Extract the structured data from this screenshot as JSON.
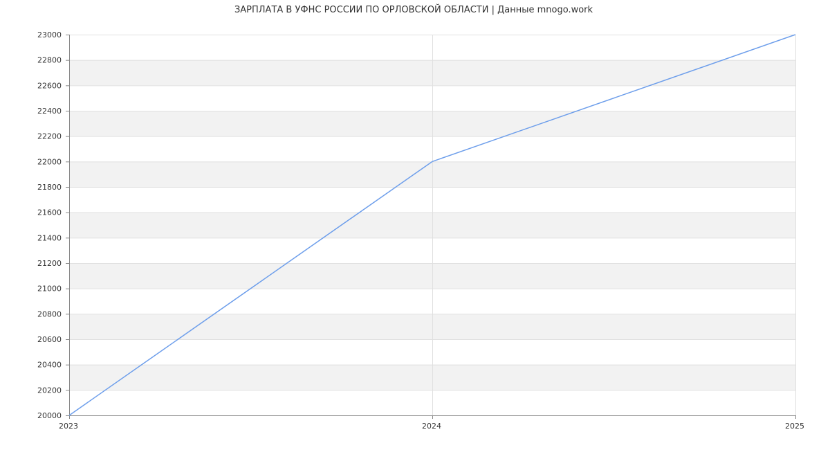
{
  "chart_data": {
    "type": "line",
    "title": "ЗАРПЛАТА В УФНС РОССИИ ПО ОРЛОВСКОЙ  ОБЛАСТИ | Данные mnogo.work",
    "xlabel": "",
    "ylabel": "",
    "x": [
      "2023",
      "2024",
      "2025"
    ],
    "series": [
      {
        "values": [
          20000,
          22000,
          23000
        ],
        "color": "#6d9eeb"
      }
    ],
    "ylim": [
      20000,
      23000
    ],
    "yticks": [
      20000,
      20200,
      20400,
      20600,
      20800,
      21000,
      21200,
      21400,
      21600,
      21800,
      22000,
      22200,
      22400,
      22600,
      22800,
      23000
    ],
    "grid": true,
    "band_colors": [
      "#ffffff",
      "#f2f2f2"
    ],
    "grid_color": "#e0e0e0",
    "axis_color": "#888888"
  }
}
